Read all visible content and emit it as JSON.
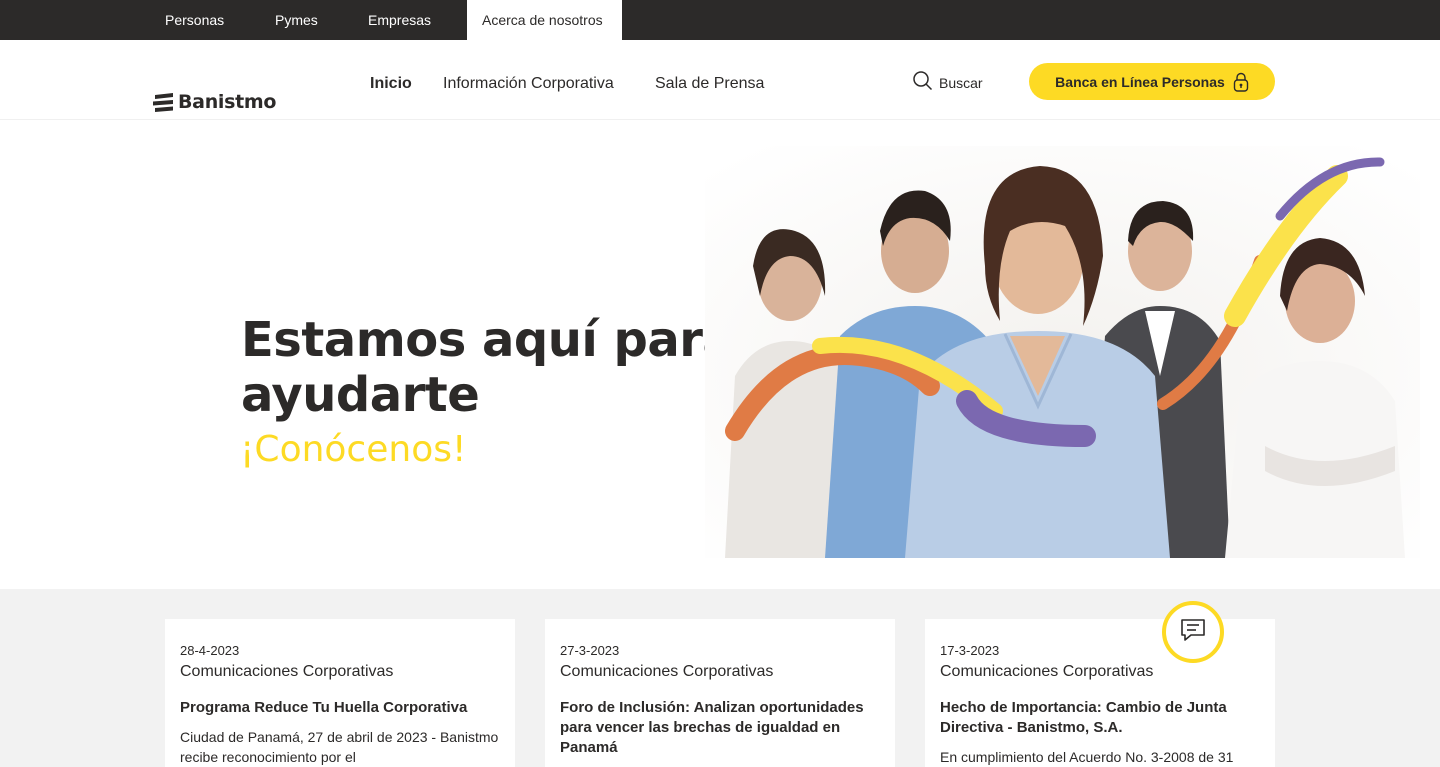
{
  "segments": [
    {
      "label": "Personas"
    },
    {
      "label": "Pymes"
    },
    {
      "label": "Empresas"
    },
    {
      "label": "Acerca de nosotros",
      "active": true
    }
  ],
  "brand": {
    "name": "Banistmo"
  },
  "nav": {
    "items": [
      {
        "label": "Inicio",
        "active": true
      },
      {
        "label": "Información Corporativa"
      },
      {
        "label": "Sala de Prensa"
      }
    ],
    "search_label": "Buscar",
    "cta_label": "Banca en Línea Personas"
  },
  "hero": {
    "title_line1": "Estamos aquí para",
    "title_line2": "ayudarte",
    "subtitle": "¡Conócenos!"
  },
  "news": [
    {
      "date": "28-4-2023",
      "category": "Comunicaciones Corporativas",
      "title": "Programa Reduce Tu Huella Corporativa",
      "excerpt": "Ciudad de Panamá, 27 de abril de 2023 - Banistmo recibe reconocimiento por el"
    },
    {
      "date": "27-3-2023",
      "category": "Comunicaciones Corporativas",
      "title": "Foro de Inclusión: Analizan oportunidades para vencer las brechas de igualdad en Panamá",
      "excerpt": ""
    },
    {
      "date": "17-3-2023",
      "category": "Comunicaciones Corporativas",
      "title": "Hecho de Importancia: Cambio de Junta Directiva - Banistmo, S.A.",
      "excerpt": "En cumplimiento del Acuerdo No. 3-2008 de 31"
    }
  ],
  "icons": {
    "search": "search-icon",
    "lock": "lock-icon",
    "chat": "chat-icon",
    "logo": "banistmo-logo-icon"
  },
  "colors": {
    "accent": "#fdda24",
    "dark": "#2c2a29",
    "orange": "#e07b45",
    "purple": "#7b68b0",
    "section_bg": "#f2f2f2"
  }
}
